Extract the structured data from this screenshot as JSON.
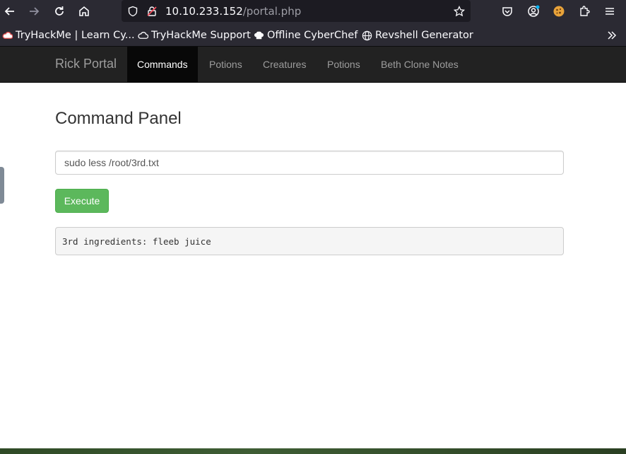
{
  "browser": {
    "url_host": "10.10.233.152",
    "url_path": "/portal.php"
  },
  "bookmarks": [
    {
      "label": "TryHackMe | Learn Cy...",
      "icon": "tryhackme-icon"
    },
    {
      "label": "TryHackMe Support",
      "icon": "cloud-icon"
    },
    {
      "label": "Offline CyberChef",
      "icon": "chef-hat-icon"
    },
    {
      "label": "Revshell Generator",
      "icon": "globe-icon"
    }
  ],
  "navbar": {
    "brand": "Rick Portal",
    "items": [
      {
        "label": "Commands",
        "active": true
      },
      {
        "label": "Potions",
        "active": false
      },
      {
        "label": "Creatures",
        "active": false
      },
      {
        "label": "Potions",
        "active": false
      },
      {
        "label": "Beth Clone Notes",
        "active": false
      }
    ]
  },
  "main": {
    "title": "Command Panel",
    "command_value": "sudo less /root/3rd.txt",
    "execute_label": "Execute",
    "output": "3rd ingredients: fleeb juice"
  },
  "colors": {
    "accent_green": "#5cb85c",
    "navbar_bg": "#222222",
    "browser_bg": "#2b2a33"
  }
}
